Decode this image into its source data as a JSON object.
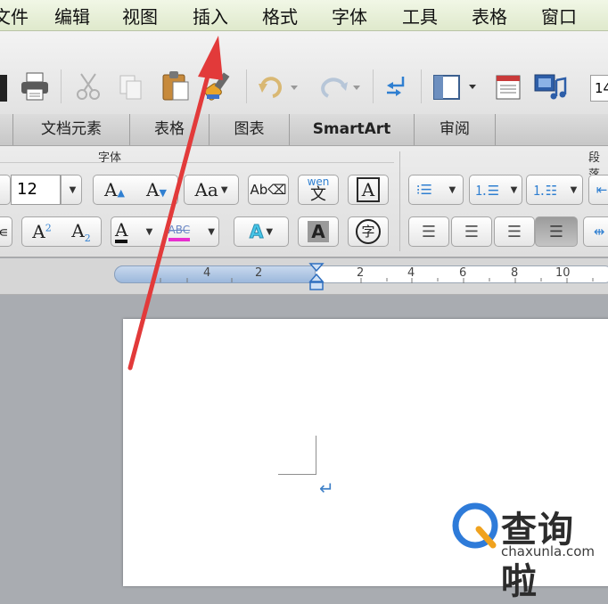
{
  "menu": {
    "items": [
      "文件",
      "编辑",
      "视图",
      "插入",
      "格式",
      "字体",
      "工具",
      "表格",
      "窗口"
    ],
    "first_visible": "文件"
  },
  "toolbar": {
    "buttons": [
      "print-icon",
      "cut-icon",
      "copy-icon",
      "paste-icon",
      "format-painter-icon",
      "undo-icon",
      "redo-icon",
      "paragraph-mark-icon",
      "sidebar-icon",
      "document-view-icon",
      "media-browser-icon"
    ],
    "zoom_partial": "14"
  },
  "ribbon_tabs": [
    "文档元素",
    "表格",
    "图表",
    "SmartArt",
    "审阅"
  ],
  "ribbon": {
    "font_group_title": "字体",
    "paragraph_group_title": "段落",
    "font_size": "12",
    "phonetic_label": "wen",
    "phonetic_char": "文",
    "outline_char": "A",
    "strikethrough_sample": "ABC",
    "enclose_char": "字"
  },
  "ruler": {
    "labels": [
      "4",
      "2",
      "2",
      "4",
      "6",
      "8",
      "10"
    ]
  },
  "watermark": {
    "brand": "查询啦",
    "domain": "chaxunla.com"
  },
  "colors": {
    "menubar": "#e8f0d9",
    "accent_arrow": "#e23a3a",
    "highlight_magenta": "#e72fcf",
    "wordart_cyan": "#47c6e8",
    "watermark_blue": "#2e7bd9",
    "watermark_orange": "#f0a21e"
  }
}
